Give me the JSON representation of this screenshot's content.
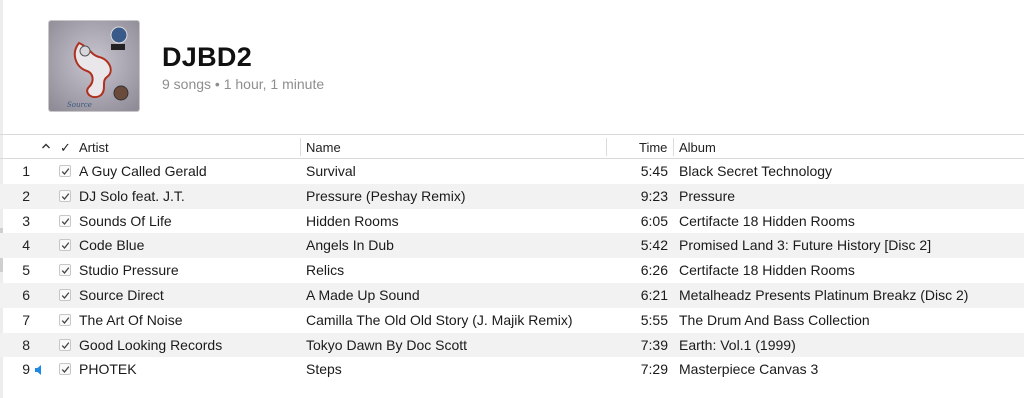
{
  "header": {
    "title": "DJBD2",
    "summary": "9 songs • 1 hour, 1 minute",
    "artwork_icon": "album-artwork"
  },
  "columns": {
    "artist": "Artist",
    "name": "Name",
    "time": "Time",
    "album": "Album",
    "sort_icon": "chevron-up-icon",
    "check_header": "✓"
  },
  "colors": {
    "playing_accent": "#1e88e5",
    "row_alt": "#f2f2f2",
    "secondary_text": "#8e8e8e"
  },
  "tracks": [
    {
      "num": "1",
      "artist": "A Guy Called Gerald",
      "name": "Survival",
      "time": "5:45",
      "album": "Black Secret Technology",
      "checked": true,
      "playing": false
    },
    {
      "num": "2",
      "artist": "DJ Solo feat. J.T.",
      "name": "Pressure (Peshay Remix)",
      "time": "9:23",
      "album": "Pressure",
      "checked": true,
      "playing": false
    },
    {
      "num": "3",
      "artist": "Sounds Of Life",
      "name": "Hidden Rooms",
      "time": "6:05",
      "album": "Certifacte 18 Hidden Rooms",
      "checked": true,
      "playing": false
    },
    {
      "num": "4",
      "artist": "Code Blue",
      "name": "Angels In Dub",
      "time": "5:42",
      "album": "Promised Land 3: Future History [Disc 2]",
      "checked": true,
      "playing": false
    },
    {
      "num": "5",
      "artist": "Studio Pressure",
      "name": "Relics",
      "time": "6:26",
      "album": "Certifacte 18 Hidden Rooms",
      "checked": true,
      "playing": false
    },
    {
      "num": "6",
      "artist": "Source Direct",
      "name": "A Made Up Sound",
      "time": "6:21",
      "album": "Metalheadz Presents Platinum Breakz (Disc 2)",
      "checked": true,
      "playing": false
    },
    {
      "num": "7",
      "artist": "The Art Of Noise",
      "name": "Camilla The Old Old Story (J. Majik Remix)",
      "time": "5:55",
      "album": "The Drum And Bass Collection",
      "checked": true,
      "playing": false
    },
    {
      "num": "8",
      "artist": "Good Looking Records",
      "name": "Tokyo Dawn By Doc Scott",
      "time": "7:39",
      "album": "Earth: Vol.1 (1999)",
      "checked": true,
      "playing": false
    },
    {
      "num": "9",
      "artist": "PHOTEK",
      "name": "Steps",
      "time": "7:29",
      "album": "Masterpiece Canvas 3",
      "checked": true,
      "playing": true
    }
  ]
}
